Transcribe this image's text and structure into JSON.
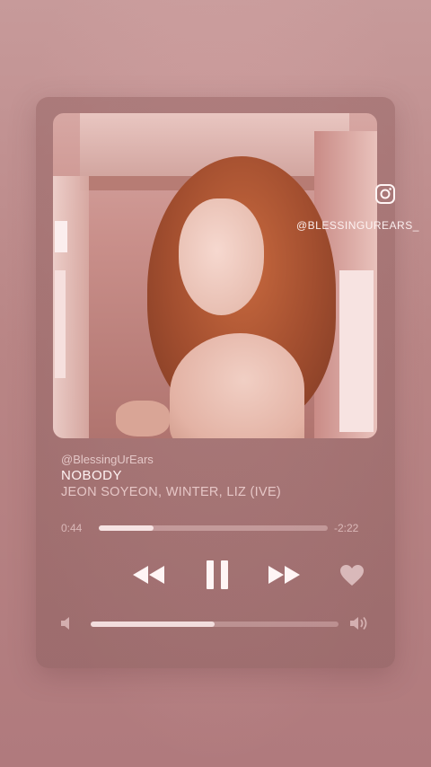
{
  "player": {
    "uploader": "@BlessingUrEars",
    "song_title": "NOBODY",
    "artists": "JEON SOYEON, WINTER, LIZ (IVE)",
    "elapsed": "0:44",
    "remaining": "-2:22",
    "progress_fraction": 0.24,
    "volume_fraction": 0.5,
    "is_playing": true,
    "album_art_alt": "album-art"
  },
  "overlay": {
    "social_icon": "instagram-icon",
    "handle": "@BLESSINGUREARS_"
  },
  "controls": {
    "rewind_icon": "rewind-icon",
    "pause_icon": "pause-icon",
    "forward_icon": "fast-forward-icon",
    "favorite_icon": "heart-icon",
    "volume_low_icon": "volume-low-icon",
    "volume_high_icon": "volume-high-icon"
  },
  "colors": {
    "background": "#b98585",
    "text_primary": "#fff3f3",
    "icon": "#fff5f5"
  }
}
